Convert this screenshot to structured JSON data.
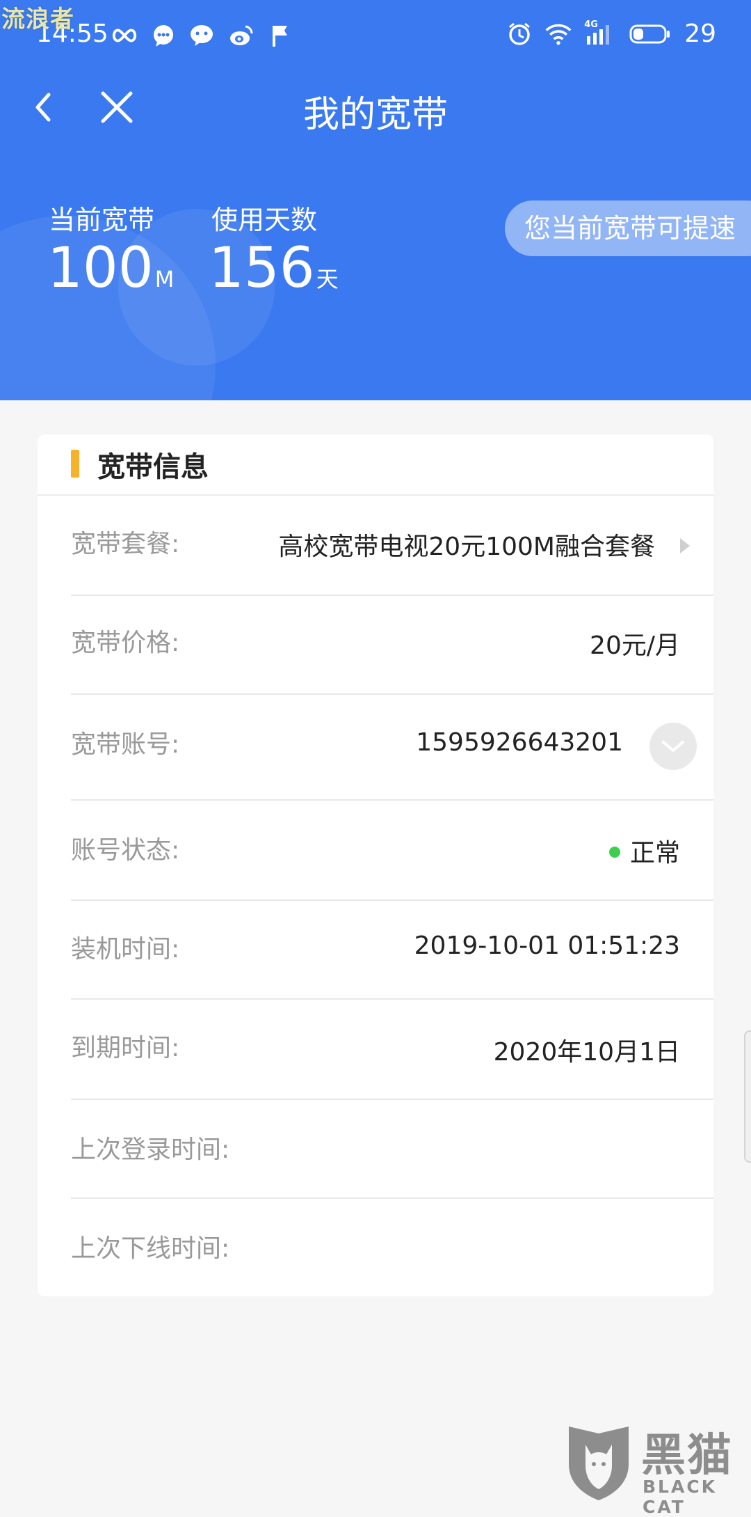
{
  "watermark": "流浪者",
  "status_bar": {
    "time": "14:55",
    "network": "4G",
    "battery": "29",
    "left_icons": [
      "infinity-icon",
      "chat-bubble-icon",
      "wechat-icon",
      "weibo-icon",
      "flag-icon"
    ],
    "right_icons": [
      "alarm-icon",
      "wifi-icon",
      "signal-icon",
      "battery-icon"
    ]
  },
  "nav": {
    "title": "我的宽带",
    "back_icon": "back-arrow-icon",
    "close_icon": "close-icon"
  },
  "summary": {
    "current_bandwidth_label": "当前宽带",
    "current_bandwidth_value": "100",
    "current_bandwidth_unit": "M",
    "usage_days_label": "使用天数",
    "usage_days_value": "156",
    "usage_days_unit": "天",
    "speedup_text": "您当前宽带可提速"
  },
  "info_card": {
    "title": "宽带信息",
    "rows": [
      {
        "label": "宽带套餐:",
        "value": "高校宽带电视20元100M融合套餐"
      },
      {
        "label": "宽带价格:",
        "value": "20元/月"
      },
      {
        "label": "宽带账号:",
        "value": "1595926643201"
      },
      {
        "label": "账号状态:",
        "value": "正常"
      },
      {
        "label": "装机时间:",
        "value": "2019-10-01 01:51:23"
      },
      {
        "label": "到期时间:",
        "value": "2020年10月1日"
      },
      {
        "label": "上次登录时间:",
        "value": ""
      },
      {
        "label": "上次下线时间:",
        "value": ""
      }
    ],
    "status_color": "#3ccf4e"
  },
  "brand": {
    "cn": "黑猫",
    "en": "BLACK CAT"
  },
  "colors": {
    "header_bg": "#3a79ef",
    "accent": "#f7b22b",
    "label": "#999999",
    "value": "#222222"
  }
}
